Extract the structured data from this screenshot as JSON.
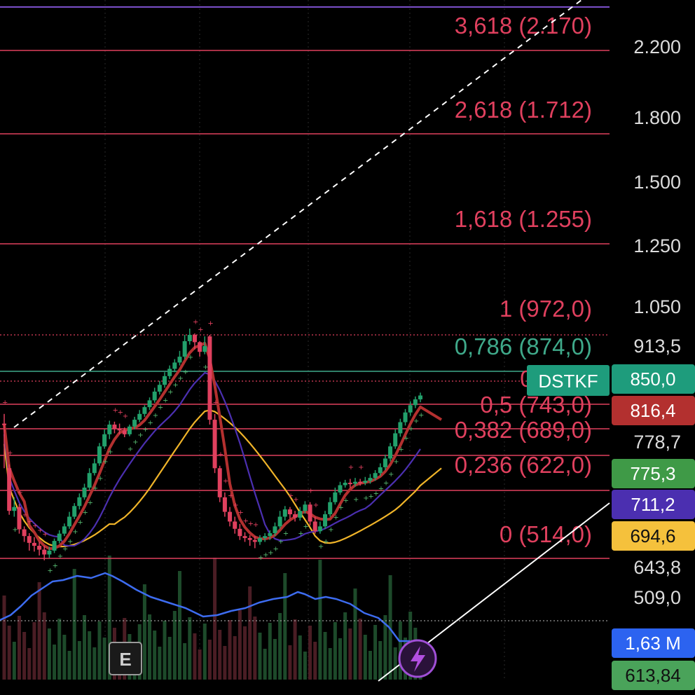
{
  "symbol": "DSTKF",
  "colors": {
    "background": "#000000",
    "fib_line": "#e0405e",
    "fib_teal": "#3fa98a",
    "candle_up": "#22a06b",
    "candle_down": "#e0405e",
    "ma_red": "#b3302f",
    "ma_purple": "#4b2fb0",
    "ma_yellow": "#f0b429",
    "obv_blue": "#3d6cf0",
    "trendline": "#ffffff",
    "psar_up": "#56b870",
    "psar_down": "#e0405e"
  },
  "fib_levels": [
    {
      "ratio": "3,618",
      "price": "2.170",
      "label": "3,618 (2.170)"
    },
    {
      "ratio": "2,618",
      "price": "1.712",
      "label": "2,618 (1.712)"
    },
    {
      "ratio": "1,618",
      "price": "1.255",
      "label": "1,618 (1.255)"
    },
    {
      "ratio": "1",
      "price": "972,0",
      "label": "1 (972,0)"
    },
    {
      "ratio": "0,786",
      "price": "874,0",
      "label": "0,786 (874,0)"
    },
    {
      "ratio": "0,618",
      "price": "",
      "label": "0,618 ("
    },
    {
      "ratio": "0,5",
      "price": "743,0",
      "label": "0,5 (743,0)"
    },
    {
      "ratio": "0,382",
      "price": "689,0",
      "label": "0,382 (689,0)"
    },
    {
      "ratio": "0,236",
      "price": "622,0",
      "label": "0,236 (622,0)"
    },
    {
      "ratio": "0",
      "price": "514,0",
      "label": "0 (514,0)"
    }
  ],
  "price_axis": [
    "2.200",
    "1.800",
    "1.500",
    "1.250",
    "1.050",
    "913,5",
    "778,7",
    "643,8",
    "509,0"
  ],
  "price_tags": [
    {
      "name": "last-price",
      "value": "850,0",
      "color": "#1e9c7c"
    },
    {
      "name": "ma-red",
      "value": "816,4",
      "color": "#b3302f"
    },
    {
      "name": "ma-green",
      "value": "775,3",
      "color": "#3f9a47"
    },
    {
      "name": "ma-purple",
      "value": "711,2",
      "color": "#4b2fb0"
    },
    {
      "name": "ma-yellow",
      "value": "694,6",
      "color": "#f5c13c"
    },
    {
      "name": "obv",
      "value": "1,63 M",
      "color": "#2c63f0"
    },
    {
      "name": "volume",
      "value": "613,84",
      "color": "#4aa35a"
    }
  ],
  "chart_data": {
    "type": "candlestick",
    "series": [
      {
        "name": "fib retracement",
        "levels": [
          "3,618 (2.170)",
          "2,618 (1.712)",
          "1,618 (1.255)",
          "1 (972,0)",
          "0,786 (874,0)",
          "0,5 (743,0)",
          "0,382 (689,0)",
          "0,236 (622,0)",
          "0 (514,0)"
        ]
      }
    ],
    "candles": [
      [
        792,
        790,
        812,
        700
      ],
      [
        700,
        612,
        708,
        604
      ],
      [
        612,
        620,
        640,
        600
      ],
      [
        620,
        574,
        626,
        565
      ],
      [
        574,
        560,
        580,
        548
      ],
      [
        560,
        546,
        566,
        530
      ],
      [
        546,
        540,
        558,
        528
      ],
      [
        540,
        532,
        548,
        520
      ],
      [
        532,
        522,
        540,
        510
      ],
      [
        522,
        530,
        538,
        515
      ],
      [
        530,
        550,
        555,
        525
      ],
      [
        550,
        565,
        572,
        545
      ],
      [
        565,
        580,
        586,
        560
      ],
      [
        580,
        600,
        610,
        575
      ],
      [
        600,
        622,
        628,
        595
      ],
      [
        622,
        640,
        648,
        615
      ],
      [
        640,
        660,
        668,
        635
      ],
      [
        660,
        690,
        700,
        655
      ],
      [
        690,
        710,
        720,
        685
      ],
      [
        710,
        745,
        752,
        705
      ],
      [
        745,
        770,
        780,
        740
      ],
      [
        770,
        790,
        798,
        760
      ],
      [
        790,
        782,
        796,
        772
      ],
      [
        782,
        778,
        792,
        770
      ],
      [
        778,
        770,
        784,
        764
      ],
      [
        770,
        786,
        790,
        766
      ],
      [
        786,
        800,
        806,
        780
      ],
      [
        800,
        812,
        820,
        795
      ],
      [
        812,
        826,
        830,
        806
      ],
      [
        826,
        840,
        846,
        820
      ],
      [
        840,
        858,
        866,
        835
      ],
      [
        858,
        872,
        880,
        852
      ],
      [
        872,
        890,
        898,
        866
      ],
      [
        890,
        905,
        912,
        884
      ],
      [
        905,
        918,
        925,
        898
      ],
      [
        918,
        930,
        942,
        912
      ],
      [
        930,
        962,
        975,
        925
      ],
      [
        962,
        975,
        988,
        955
      ],
      [
        975,
        960,
        978,
        945
      ],
      [
        960,
        940,
        962,
        930
      ],
      [
        940,
        952,
        972,
        935
      ],
      [
        972,
        800,
        975,
        790
      ],
      [
        800,
        700,
        812,
        690
      ],
      [
        700,
        640,
        705,
        630
      ],
      [
        640,
        610,
        650,
        600
      ],
      [
        610,
        590,
        620,
        580
      ],
      [
        590,
        575,
        600,
        565
      ],
      [
        575,
        560,
        585,
        552
      ],
      [
        560,
        556,
        568,
        548
      ],
      [
        556,
        552,
        562,
        540
      ],
      [
        552,
        548,
        560,
        535
      ],
      [
        548,
        556,
        562,
        542
      ],
      [
        556,
        560,
        566,
        548
      ],
      [
        560,
        566,
        572,
        552
      ],
      [
        566,
        580,
        588,
        560
      ],
      [
        580,
        600,
        612,
        575
      ],
      [
        600,
        615,
        622,
        592
      ],
      [
        615,
        605,
        620,
        596
      ],
      [
        605,
        598,
        612,
        590
      ],
      [
        598,
        612,
        620,
        592
      ],
      [
        612,
        625,
        632,
        606
      ],
      [
        625,
        590,
        630,
        582
      ],
      [
        590,
        570,
        600,
        565
      ],
      [
        570,
        580,
        590,
        565
      ],
      [
        580,
        605,
        612,
        575
      ],
      [
        605,
        630,
        640,
        600
      ],
      [
        630,
        650,
        660,
        625
      ],
      [
        650,
        665,
        672,
        645
      ],
      [
        665,
        670,
        676,
        660
      ],
      [
        670,
        668,
        678,
        660
      ],
      [
        668,
        672,
        680,
        662
      ],
      [
        672,
        670,
        678,
        664
      ],
      [
        670,
        674,
        682,
        665
      ],
      [
        674,
        680,
        688,
        668
      ],
      [
        680,
        690,
        696,
        674
      ],
      [
        690,
        702,
        710,
        684
      ],
      [
        702,
        720,
        728,
        696
      ],
      [
        720,
        745,
        752,
        714
      ],
      [
        745,
        772,
        780,
        740
      ],
      [
        772,
        795,
        802,
        765
      ],
      [
        795,
        815,
        822,
        788
      ],
      [
        815,
        830,
        838,
        808
      ],
      [
        830,
        842,
        848,
        824
      ],
      [
        842,
        850,
        856,
        836
      ]
    ],
    "price_range": [
      440,
      2300
    ]
  }
}
